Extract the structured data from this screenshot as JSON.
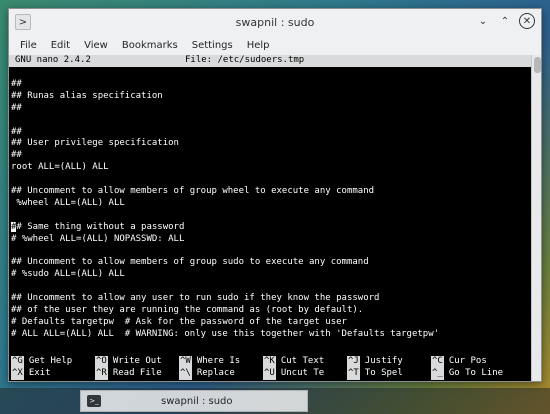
{
  "window": {
    "title": "swapnil : sudo",
    "menu": [
      "File",
      "Edit",
      "View",
      "Bookmarks",
      "Settings",
      "Help"
    ]
  },
  "nano": {
    "version": "GNU nano 2.4.2",
    "file": "File: /etc/sudoers.tmp",
    "lines": [
      "##",
      "## Runas alias specification",
      "##",
      "",
      "##",
      "## User privilege specification",
      "##",
      "root ALL=(ALL) ALL",
      "",
      "## Uncomment to allow members of group wheel to execute any command",
      " %wheel ALL=(ALL) ALL",
      "",
      "## Same thing without a password",
      "# %wheel ALL=(ALL) NOPASSWD: ALL",
      "",
      "## Uncomment to allow members of group sudo to execute any command",
      "# %sudo ALL=(ALL) ALL",
      "",
      "## Uncomment to allow any user to run sudo if they know the password",
      "## of the user they are running the command as (root by default).",
      "# Defaults targetpw  # Ask for the password of the target user",
      "# ALL ALL=(ALL) ALL  # WARNING: only use this together with 'Defaults targetpw'"
    ],
    "cursor_line": 12,
    "cursor_char": "#",
    "cursor_rest": "# Same thing without a password",
    "shortcuts_row1": [
      {
        "key": "^G",
        "label": "Get Help"
      },
      {
        "key": "^O",
        "label": "Write Out"
      },
      {
        "key": "^W",
        "label": "Where Is"
      },
      {
        "key": "^K",
        "label": "Cut Text"
      },
      {
        "key": "^J",
        "label": "Justify"
      },
      {
        "key": "^C",
        "label": "Cur Pos"
      }
    ],
    "shortcuts_row2": [
      {
        "key": "^X",
        "label": "Exit"
      },
      {
        "key": "^R",
        "label": "Read File"
      },
      {
        "key": "^\\",
        "label": "Replace"
      },
      {
        "key": "^U",
        "label": "Uncut Te"
      },
      {
        "key": "^T",
        "label": "To Spel"
      },
      {
        "key": "^_",
        "label": "Go To Line"
      }
    ]
  },
  "taskbar": {
    "task_title": "swapnil : sudo",
    "task_icon": ">_"
  },
  "colors": {
    "terminal_bg": "#000000",
    "terminal_fg": "#ffffff",
    "nano_bar": "#d9dadb"
  }
}
